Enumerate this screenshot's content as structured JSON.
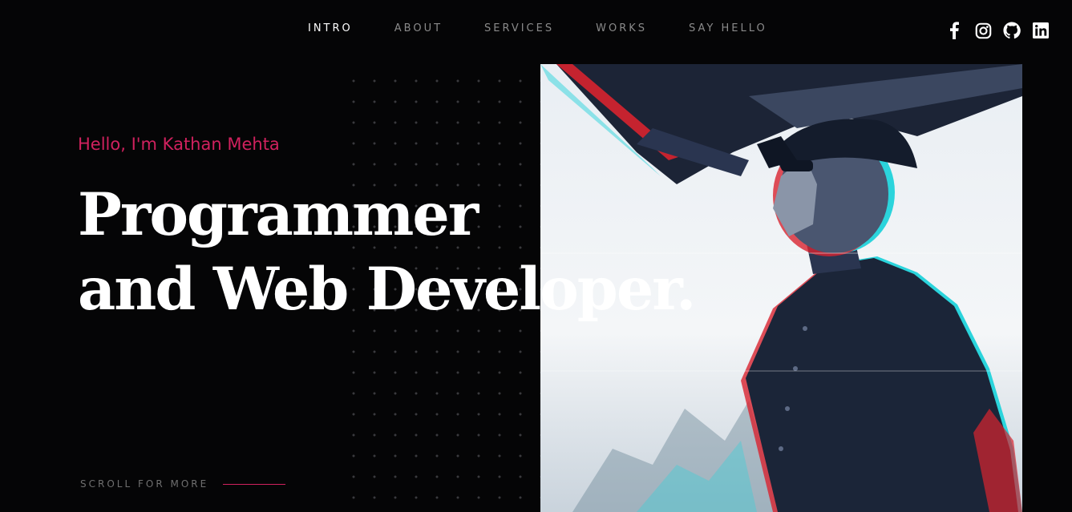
{
  "nav": {
    "items": [
      {
        "label": "INTRO",
        "active": true
      },
      {
        "label": "ABOUT",
        "active": false
      },
      {
        "label": "SERVICES",
        "active": false
      },
      {
        "label": "WORKS",
        "active": false
      },
      {
        "label": "SAY HELLO",
        "active": false
      }
    ]
  },
  "social": {
    "icons": [
      "facebook-icon",
      "instagram-icon",
      "github-icon",
      "linkedin-icon"
    ]
  },
  "hero": {
    "greeting": "Hello, I'm Kathan Mehta",
    "headline_line1": "Programmer",
    "headline_line2": "and Web Developer.",
    "scroll_label": "SCROLL FOR MORE"
  },
  "colors": {
    "background": "#050506",
    "accent": "#d0215e",
    "nav_inactive": "#8a8a8a",
    "text": "#ffffff"
  }
}
